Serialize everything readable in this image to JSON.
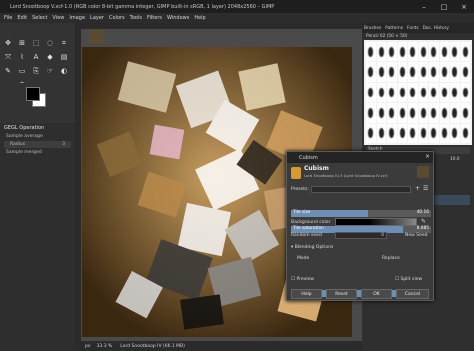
{
  "window": {
    "title": "Lord Snootboop V.xcf-1.0 (RGB color 8-bit gamma integer, GIMP built-in sRGB, 1 layer) 2048x2560 – GIMP"
  },
  "menu": [
    "File",
    "Edit",
    "Select",
    "View",
    "Image",
    "Layer",
    "Colors",
    "Tools",
    "Filters",
    "Windows",
    "Help"
  ],
  "toolbox": {
    "gegl_title": "GEGL Operation",
    "sample_mode": "Sample average",
    "radius_label": "Radius",
    "radius_value": "3",
    "sample_merged": "Sample merged"
  },
  "statusbar": {
    "unit": "px",
    "zoom": "33.3 %",
    "layer": "Lord Snootboop IV (66.1 MB)"
  },
  "dock": {
    "tabs": [
      "Brushes",
      "Patterns",
      "Fonts",
      "Doc. History"
    ],
    "brush_name": "Pencil 02 (50 × 50)",
    "tag_label": "Sketch",
    "spacing_label": "Spacing",
    "spacing_value": "10.0",
    "layer_name": "Lord Snootboop IV",
    "mode_label": "Normal"
  },
  "dialog": {
    "title": "Cubism",
    "heading": "Cubism",
    "subheading": "Lord Snootboop IV-3 (Lord Snootboop IV.xcf)",
    "presets_label": "Presets:",
    "tile_size_label": "Tile size",
    "tile_size_value": "40.16",
    "tile_size_fraction": 0.55,
    "tile_sat_label": "Tile saturation",
    "tile_sat_value": "8.085",
    "tile_sat_fraction": 0.8,
    "bg_color_label": "Background color",
    "random_seed_label": "Random seed",
    "random_seed_value": "0",
    "new_seed_label": "New Seed",
    "blending_label": "Blending Options",
    "mode_label": "Mode",
    "mode_value": "Replace",
    "opacity_label": "Opacity",
    "opacity_value": "100.0",
    "opacity_fraction": 1.0,
    "preview_label": "Preview",
    "split_label": "Split view",
    "buttons": {
      "help": "Help",
      "reset": "Reset",
      "ok": "OK",
      "cancel": "Cancel"
    }
  }
}
